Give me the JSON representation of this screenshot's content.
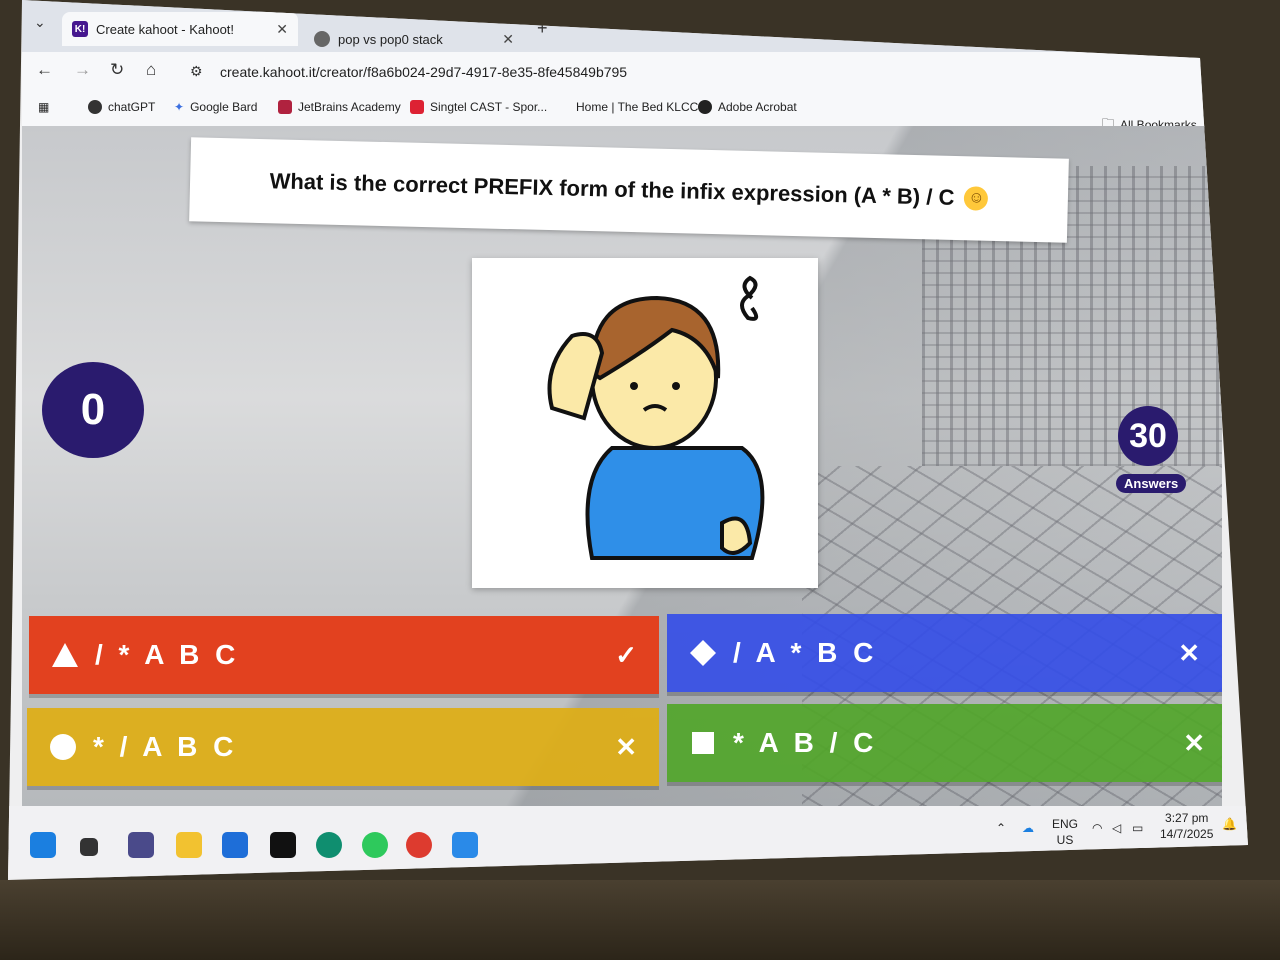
{
  "browser": {
    "tabs": [
      {
        "title": "Create kahoot - Kahoot!",
        "favicon": "K!",
        "active": true
      },
      {
        "title": "pop vs pop0 stack",
        "favicon": "",
        "active": false
      }
    ],
    "new_tab": "+",
    "url": "create.kahoot.it/creator/f8a6b024-29d7-4917-8e35-8fe45849b795",
    "bookmarks": [
      "chatGPT",
      "Google Bard",
      "JetBrains Academy",
      "Singtel CAST - Spor...",
      "Home | The Bed KLCC",
      "Adobe Acrobat"
    ],
    "all_bookmarks": "All Bookmarks"
  },
  "quiz": {
    "question": "What is the correct PREFIX form of the infix expression (A * B) / C",
    "timer": "0",
    "answers_count": "30",
    "answers_label": "Answers",
    "answers": [
      {
        "text": "/ * A B C",
        "shape": "triangle",
        "color": "#e2411f",
        "correct": true
      },
      {
        "text": "/ A * B C",
        "shape": "diamond",
        "color": "#334ce8",
        "correct": false
      },
      {
        "text": "* / A B C",
        "shape": "circle",
        "color": "#deae14",
        "correct": false
      },
      {
        "text": "* A B / C",
        "shape": "square",
        "color": "#50a528",
        "correct": false
      }
    ],
    "correct_mark": "✓",
    "wrong_mark": "✕"
  },
  "taskbar": {
    "language": "ENG",
    "region": "US",
    "time": "3:27 pm",
    "date": "14/7/2025"
  },
  "colors": {
    "kahoot_purple": "#2a1b6e",
    "red": "#e2411f",
    "blue": "#334ce8",
    "yellow": "#deae14",
    "green": "#50a528"
  }
}
